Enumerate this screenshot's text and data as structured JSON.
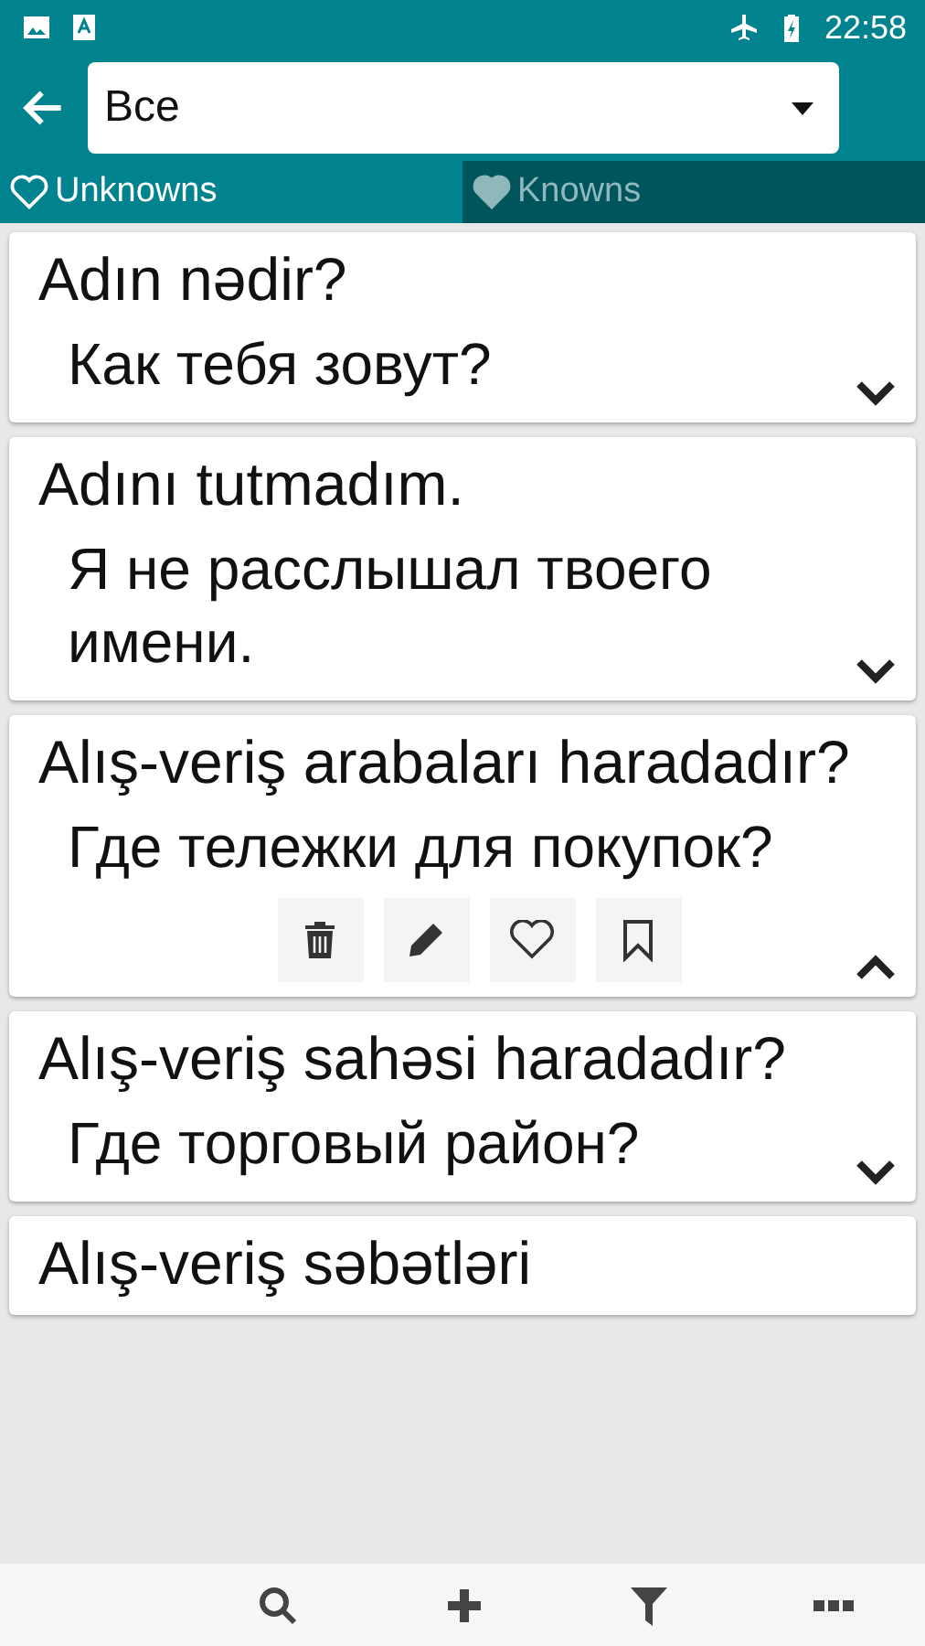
{
  "status_bar": {
    "time": "22:58"
  },
  "toolbar": {
    "filter_value": "Все"
  },
  "tabs": [
    {
      "label": "Unknowns",
      "selected": true
    },
    {
      "label": "Knowns",
      "selected": false
    }
  ],
  "cards": [
    {
      "phrase": "Adın nədir?",
      "translation": "Как тебя зовут?",
      "expanded": false
    },
    {
      "phrase": "Adını tutmadım.",
      "translation": "Я не расслышал твоего имени.",
      "expanded": false
    },
    {
      "phrase": "Alış-veriş arabaları haradadır?",
      "translation": "Где тележки для покупок?",
      "expanded": true
    },
    {
      "phrase": "Alış-veriş sahəsi haradadır?",
      "translation": "Где торговый район?",
      "expanded": false
    },
    {
      "phrase": "Alış-veriş səbətləri"
    }
  ]
}
